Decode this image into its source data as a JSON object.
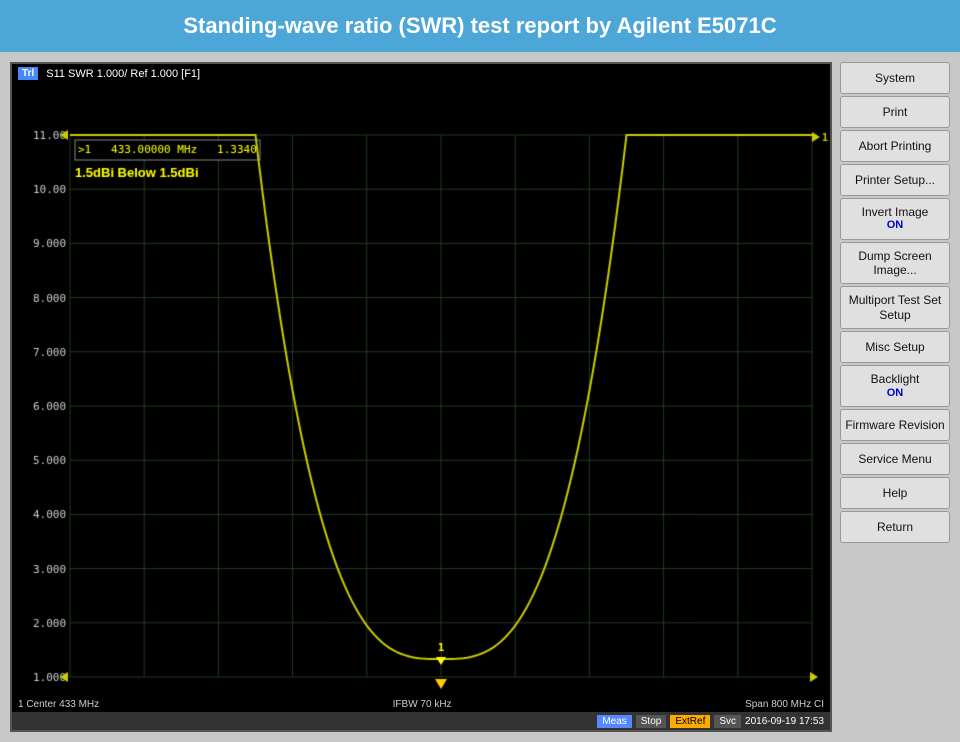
{
  "header": {
    "title": "Standing-wave ratio (SWR) test report by Agilent E5071C"
  },
  "chart": {
    "trl_badge": "Trl",
    "channel_info": "S11  SWR 1.000/ Ref 1.000 [F1]",
    "marker_info": ">1   433.00000 MHz   1.3340",
    "annotation": "1.5dBi Below 1.5dBi",
    "y_axis": {
      "max": "11.00",
      "values": [
        "10.00",
        "9.000",
        "8.000",
        "7.000",
        "6.000",
        "5.000",
        "4.000",
        "3.000",
        "2.000",
        "1.000"
      ]
    },
    "x_axis": {
      "marker_triangle": "1",
      "center_label": "1  Center 433 MHz",
      "ifbw_label": "IFBW 70 kHz",
      "span_label": "Span 800 MHz  CI"
    }
  },
  "status_bar": {
    "meas": "Meas",
    "stop": "Stop",
    "extref": "ExtRef",
    "svc": "Svc",
    "timestamp": "2016-09-19 17:53"
  },
  "sidebar": {
    "buttons": [
      {
        "id": "system",
        "label": "System",
        "sub": null
      },
      {
        "id": "print",
        "label": "Print",
        "sub": null
      },
      {
        "id": "abort-printing",
        "label": "Abort Printing",
        "sub": null
      },
      {
        "id": "printer-setup",
        "label": "Printer Setup...",
        "sub": null
      },
      {
        "id": "invert-image",
        "label": "Invert Image",
        "sub": "ON"
      },
      {
        "id": "dump-screen-image",
        "label": "Dump\nScreen Image...",
        "sub": null
      },
      {
        "id": "multiport-test-set-setup",
        "label": "Multiport Test Set\nSetup",
        "sub": null
      },
      {
        "id": "misc-setup",
        "label": "Misc Setup",
        "sub": null
      },
      {
        "id": "backlight",
        "label": "Backlight",
        "sub": "ON"
      },
      {
        "id": "firmware-revision",
        "label": "Firmware\nRevision",
        "sub": null
      },
      {
        "id": "service-menu",
        "label": "Service Menu",
        "sub": null
      },
      {
        "id": "help",
        "label": "Help",
        "sub": null
      },
      {
        "id": "return",
        "label": "Return",
        "sub": null
      }
    ]
  }
}
